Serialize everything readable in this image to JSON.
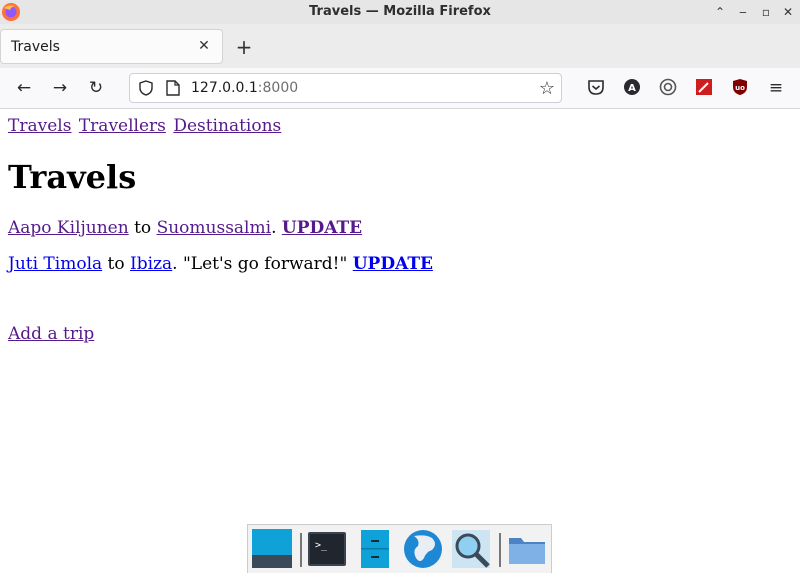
{
  "window": {
    "title": "Travels — Mozilla Firefox"
  },
  "tab": {
    "title": "Travels",
    "close_glyph": "✕",
    "new_tab_glyph": "+"
  },
  "navbar": {
    "url_host": "127.0.0.1",
    "url_port": ":8000"
  },
  "page": {
    "nav": {
      "travels": "Travels",
      "travellers": "Travellers",
      "destinations": "Destinations"
    },
    "heading": "Travels",
    "trips": [
      {
        "traveller": "Aapo Kiljunen",
        "connector": "to",
        "destination": "Suomussalmi",
        "note": ".",
        "update": "UPDATE"
      },
      {
        "traveller": "Juti Timola",
        "connector": "to",
        "destination": "Ibiza",
        "note": ". \"Let's go forward!\"",
        "update": "UPDATE"
      }
    ],
    "add_trip": "Add a trip"
  },
  "colors": {
    "visited_link": "#551a8b",
    "unvisited_link": "#0000ee",
    "dock_blue": "#0fa2d8"
  },
  "dock": {
    "items": [
      "desktop-icon",
      "terminal-icon",
      "file-manager-icon",
      "web-browser-icon",
      "search-icon",
      "folder-icon"
    ]
  }
}
